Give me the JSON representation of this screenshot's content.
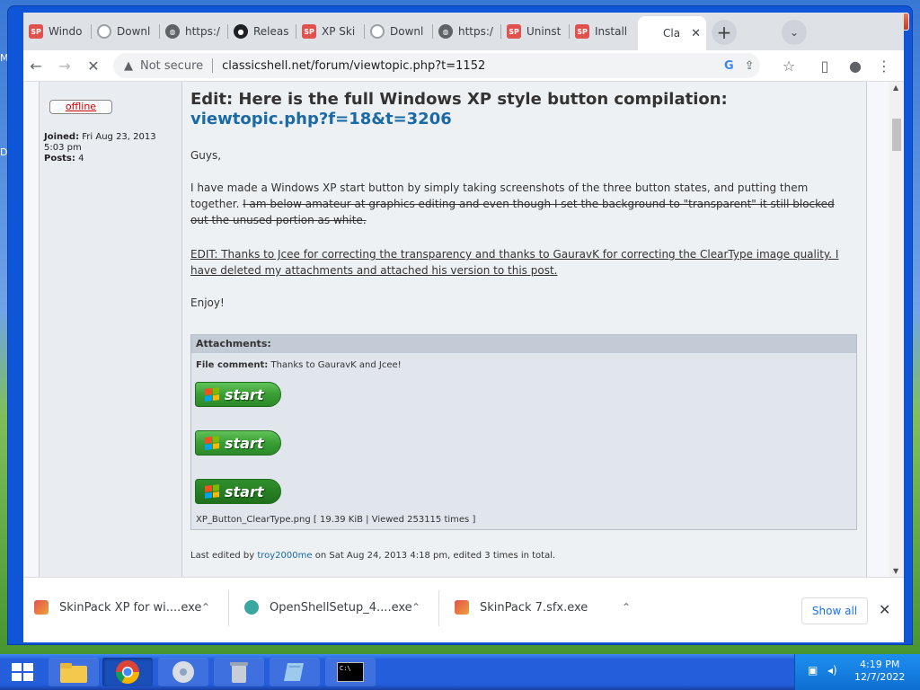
{
  "desktop": {
    "left_letters": [
      "M",
      "D"
    ]
  },
  "browser": {
    "tabs": [
      {
        "label": "Windo",
        "icon": "skinpack-icon",
        "color": "#e0524d"
      },
      {
        "label": "Downl",
        "icon": "spinner-icon",
        "color": "#9aa0a6"
      },
      {
        "label": "https:/",
        "icon": "globe-icon",
        "color": "#5f6368"
      },
      {
        "label": "Releas",
        "icon": "github-icon",
        "color": "#202124"
      },
      {
        "label": "XP Ski",
        "icon": "skinpack-icon",
        "color": "#e0524d"
      },
      {
        "label": "Downl",
        "icon": "spinner-icon",
        "color": "#9aa0a6"
      },
      {
        "label": "https:/",
        "icon": "globe-icon",
        "color": "#5f6368"
      },
      {
        "label": "Uninst",
        "icon": "skinpack-icon",
        "color": "#e0524d"
      },
      {
        "label": "Install",
        "icon": "skinpack-icon",
        "color": "#e0524d"
      },
      {
        "label": "Cla",
        "icon": "loading-icon",
        "color": "#9aa0a6",
        "active": true
      }
    ],
    "new_tab_glyph": "+",
    "tab_search_glyph": "⌄",
    "tab_close_glyph": "✕",
    "window_buttons": {
      "minimize": "–",
      "maximize": "□",
      "close": "✕"
    },
    "nav": {
      "back": "←",
      "forward": "→",
      "stop": "✕"
    },
    "security_text": "Not secure",
    "url": "classicshell.net/forum/viewtopic.php?t=1152",
    "toolbar_icons": {
      "google": "G",
      "share": "⇪",
      "star": "☆",
      "sidepanel": "▯",
      "profile": "●",
      "menu": "⋮"
    }
  },
  "post": {
    "profile": {
      "status": "offline",
      "joined_label": "Joined:",
      "joined_value": "Fri Aug 23, 2013 5:03 pm",
      "posts_label": "Posts:",
      "posts_value": "4"
    },
    "subject_text": "Edit: Here is the full Windows XP style button compilation: ",
    "subject_link": "viewtopic.php?f=18&t=3206",
    "greeting": "Guys,",
    "body_normal": "I have made a Windows XP start button by simply taking screenshots of the three button states, and putting them together. ",
    "body_struck": "I am below amateur at graphics editing and even though I set the background to \"transparent\" it still blocked out the unused portion as white.",
    "edit_note": "EDIT: Thanks to Jcee for correcting the transparency and thanks to GauravK for correcting the ClearType image quality. I have deleted my attachments and attached his version to this post.",
    "closing": "Enjoy!",
    "attachments": {
      "header": "Attachments:",
      "comment_label": "File comment:",
      "comment_text": "Thanks to GauravK and Jcee!",
      "button_word": "start",
      "file_line": "XP_Button_ClearType.png [ 19.39 KiB | Viewed 253115 times ]"
    },
    "last_edit_prefix": "Last edited by ",
    "last_edit_user": "troy2000me",
    "last_edit_suffix": " on Sat Aug 24, 2013 4:18 pm, edited 3 times in total."
  },
  "downloads": {
    "items": [
      {
        "name": "SkinPack XP for wi....exe",
        "icon": "installer-icon"
      },
      {
        "name": "OpenShellSetup_4....exe",
        "icon": "shell-icon"
      },
      {
        "name": "SkinPack 7.sfx.exe",
        "icon": "installer-icon"
      }
    ],
    "chevron": "⌃",
    "show_all": "Show all",
    "close_glyph": "✕"
  },
  "taskbar": {
    "apps": [
      "file-explorer-icon",
      "chrome-icon",
      "media-player-icon",
      "recycle-bin-icon",
      "notepad-icon",
      "command-prompt-icon"
    ],
    "cmd_text": "C:\\",
    "time": "4:19 PM",
    "date": "12/7/2022"
  }
}
